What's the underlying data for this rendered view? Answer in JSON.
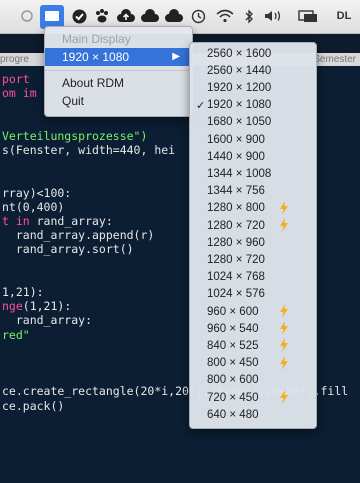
{
  "menubar": {
    "icons": [
      "circle-icon",
      "rdm-display-icon",
      "check-badge-icon",
      "paw-icon",
      "cloud-upload-icon",
      "cloud-icon",
      "time-machine-icon",
      "wifi-icon",
      "bluetooth-icon",
      "volume-icon",
      "display-mirror-icon"
    ],
    "right_text": "DL"
  },
  "background_tabs": {
    "left": "progre",
    "right": "Semester"
  },
  "rdm_menu": {
    "main_display_label": "Main Display",
    "resolution_item": "1920 × 1080",
    "about_label": "About RDM",
    "quit_label": "Quit"
  },
  "resolutions": [
    {
      "label": "2560 × 1600",
      "checked": false,
      "bolt": false
    },
    {
      "label": "2560 × 1440",
      "checked": false,
      "bolt": false
    },
    {
      "label": "1920 × 1200",
      "checked": false,
      "bolt": false
    },
    {
      "label": "1920 × 1080",
      "checked": true,
      "bolt": false
    },
    {
      "label": "1680 × 1050",
      "checked": false,
      "bolt": false
    },
    {
      "label": "1600 × 900",
      "checked": false,
      "bolt": false
    },
    {
      "label": "1440 × 900",
      "checked": false,
      "bolt": false
    },
    {
      "label": "1344 × 1008",
      "checked": false,
      "bolt": false
    },
    {
      "label": "1344 × 756",
      "checked": false,
      "bolt": false
    },
    {
      "label": "1280 × 800",
      "checked": false,
      "bolt": true
    },
    {
      "label": "1280 × 720",
      "checked": false,
      "bolt": true
    },
    {
      "label": "1280 × 960",
      "checked": false,
      "bolt": false
    },
    {
      "label": "1280 × 720",
      "checked": false,
      "bolt": false
    },
    {
      "label": "1024 × 768",
      "checked": false,
      "bolt": false
    },
    {
      "label": "1024 × 576",
      "checked": false,
      "bolt": false
    },
    {
      "label": "960 × 600",
      "checked": false,
      "bolt": true
    },
    {
      "label": "960 × 540",
      "checked": false,
      "bolt": true
    },
    {
      "label": "840 × 525",
      "checked": false,
      "bolt": true
    },
    {
      "label": "800 × 450",
      "checked": false,
      "bolt": true
    },
    {
      "label": "800 × 600",
      "checked": false,
      "bolt": false
    },
    {
      "label": "720 × 450",
      "checked": false,
      "bolt": true
    },
    {
      "label": "640 × 480",
      "checked": false,
      "bolt": false
    }
  ],
  "code_lines": [
    [
      {
        "t": "port",
        "c": "kw"
      }
    ],
    [
      {
        "t": "om im",
        "c": "kw"
      }
    ],
    [],
    [],
    [
      {
        "t": "Verteilungsprozesse\")",
        "c": "str"
      }
    ],
    [
      {
        "t": "s(Fenster, width=440, hei",
        "c": "nm"
      }
    ],
    [],
    [],
    [
      {
        "t": "rray)<100:",
        "c": "nm"
      }
    ],
    [
      {
        "t": "nt(0,400)",
        "c": "nm"
      }
    ],
    [
      {
        "t": "t in ",
        "c": "kw"
      },
      {
        "t": "rand_array:",
        "c": "nm"
      }
    ],
    [
      {
        "t": "  rand_array.append(r)",
        "c": "nm"
      }
    ],
    [
      {
        "t": "  rand_array.sort()",
        "c": "nm"
      }
    ],
    [],
    [],
    [
      {
        "t": "1,21):",
        "c": "nm"
      }
    ],
    [
      {
        "t": "nge",
        "c": "kw"
      },
      {
        "t": "(1,21):",
        "c": "nm"
      }
    ],
    [
      {
        "t": "  rand_array:",
        "c": "nm"
      }
    ],
    [
      {
        "t": "red\"",
        "c": "str"
      }
    ],
    [],
    [],
    [],
    [
      {
        "t": "ce.create_rectangle(20*i,20*j,20+20*i,20+20*j,fill",
        "c": "nm"
      }
    ],
    [
      {
        "t": "ce.pack()",
        "c": "nm"
      }
    ]
  ],
  "colors": {
    "editor_bg": "#0b1e33",
    "keyword": "#ff4fa0",
    "string": "#7cf06a",
    "highlight": "#3572d9",
    "bolt": "#f2b01e"
  }
}
